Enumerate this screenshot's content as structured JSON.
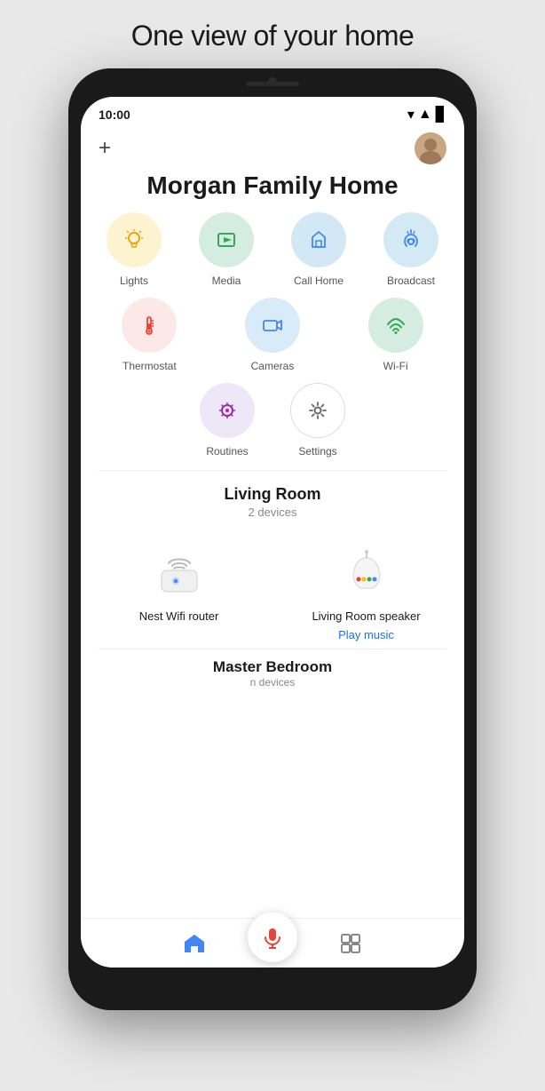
{
  "page": {
    "title": "One view of your home"
  },
  "status_bar": {
    "time": "10:00",
    "wifi": "▼",
    "signal": "▲",
    "battery": "▌"
  },
  "header": {
    "add_label": "+",
    "avatar_emoji": "👩"
  },
  "home": {
    "title": "Morgan Family Home"
  },
  "shortcuts": {
    "row1": [
      {
        "id": "lights",
        "label": "Lights",
        "color_class": "lights"
      },
      {
        "id": "media",
        "label": "Media",
        "color_class": "media"
      },
      {
        "id": "callhome",
        "label": "Call Home",
        "color_class": "callhome"
      },
      {
        "id": "broadcast",
        "label": "Broadcast",
        "color_class": "broadcast"
      }
    ],
    "row2": [
      {
        "id": "thermostat",
        "label": "Thermostat",
        "color_class": "thermostat"
      },
      {
        "id": "cameras",
        "label": "Cameras",
        "color_class": "cameras"
      },
      {
        "id": "wifi",
        "label": "Wi-Fi",
        "color_class": "wifi"
      }
    ],
    "row3": [
      {
        "id": "routines",
        "label": "Routines",
        "color_class": "routines"
      },
      {
        "id": "settings",
        "label": "Settings",
        "color_class": "settings"
      }
    ]
  },
  "rooms": [
    {
      "name": "Living Room",
      "device_count": "2 devices",
      "devices": [
        {
          "name": "Nest Wifi router",
          "type": "router"
        },
        {
          "name": "Living Room speaker",
          "type": "speaker",
          "action": "Play music"
        }
      ]
    },
    {
      "name": "Master Bedroom",
      "device_count": "n devices"
    }
  ],
  "bottom_nav": {
    "home_label": "home",
    "mic_label": "mic",
    "devices_label": "devices"
  }
}
